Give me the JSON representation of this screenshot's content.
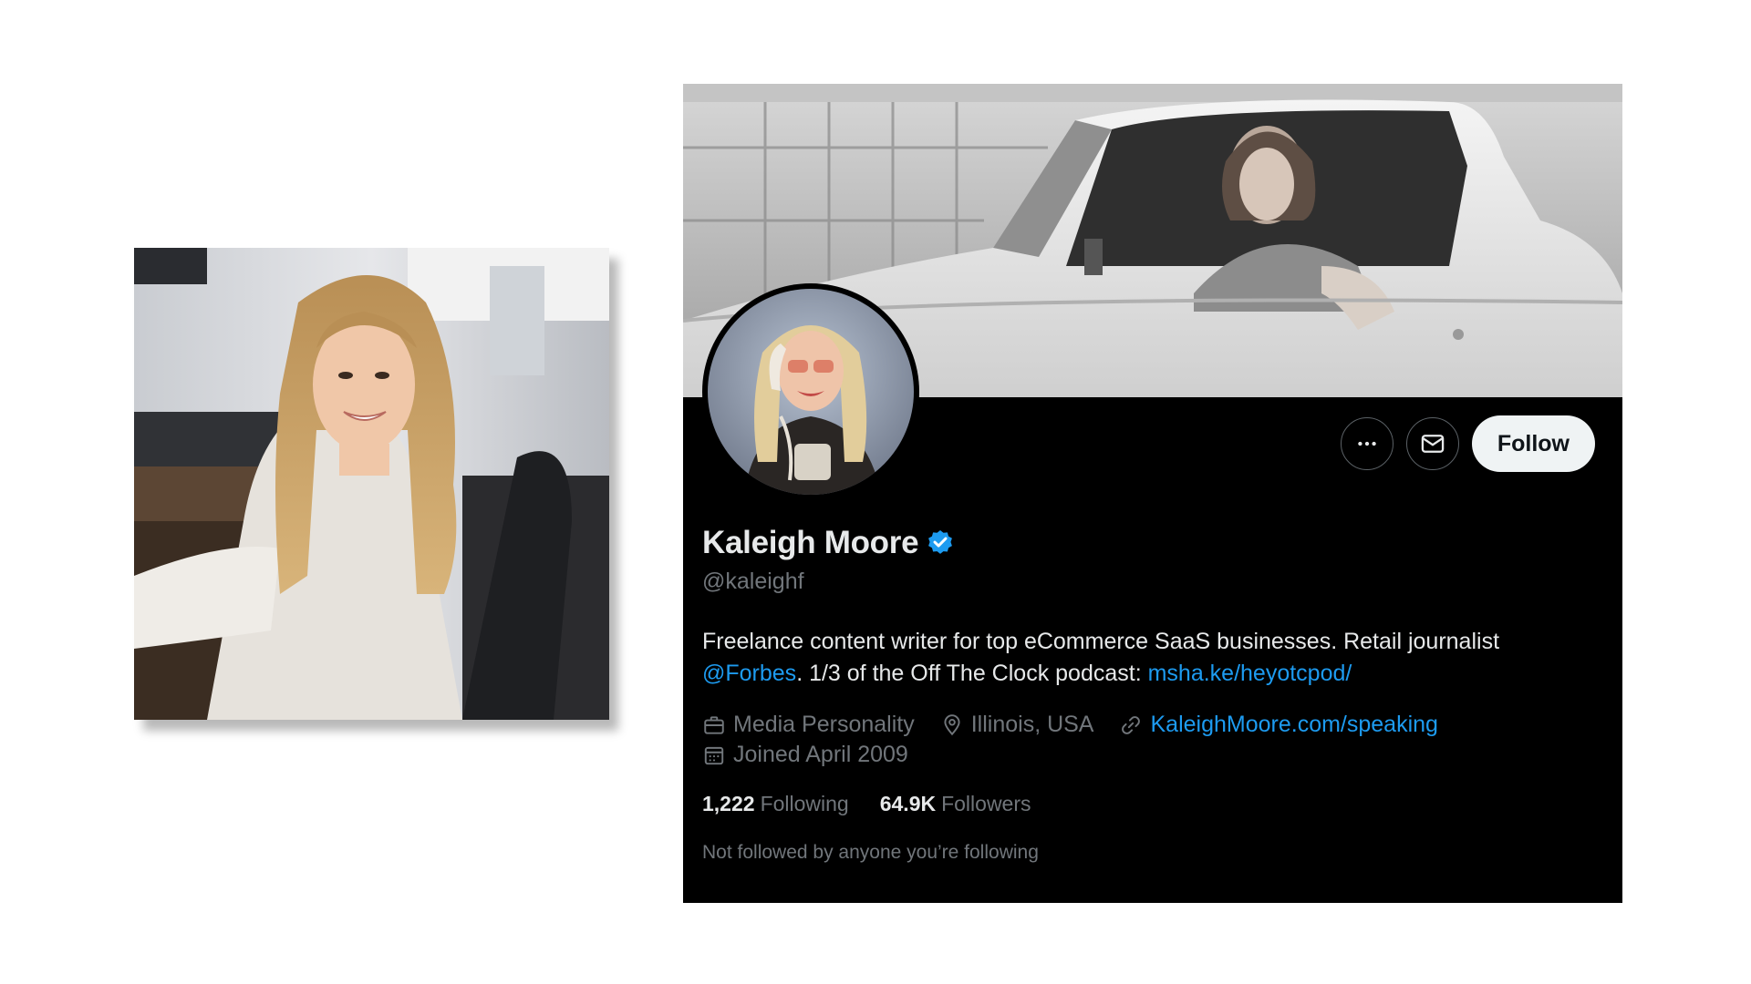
{
  "profile": {
    "display_name": "Kaleigh Moore",
    "handle": "@kaleighf",
    "verified": true,
    "bio": {
      "part1": "Freelance content writer for top eCommerce SaaS businesses. Retail journalist ",
      "mention": "@Forbes",
      "part2": ". 1/3 of the Off The Clock podcast: ",
      "link": "msha.ke/heyotcpod/"
    },
    "category": "Media Personality",
    "location": "Illinois, USA",
    "website": "KaleighMoore.com/speaking",
    "joined": "Joined April 2009",
    "following_count": "1,222",
    "following_label": "Following",
    "followers_count": "64.9K",
    "followers_label": "Followers",
    "followed_note": "Not followed by anyone you’re following"
  },
  "actions": {
    "more_icon": "more-horizontal-icon",
    "message_icon": "envelope-icon",
    "follow_label": "Follow"
  },
  "colors": {
    "card_background": "#000000",
    "link": "#1d9bf0",
    "verified_badge": "#1d9bf0",
    "muted_text": "#71767b",
    "primary_text": "#e7e9ea",
    "follow_button_bg": "#eff3f4"
  },
  "icons": {
    "category": "briefcase-icon",
    "location": "map-pin-icon",
    "website": "link-icon",
    "joined": "calendar-icon",
    "verified": "verified-badge-icon"
  }
}
